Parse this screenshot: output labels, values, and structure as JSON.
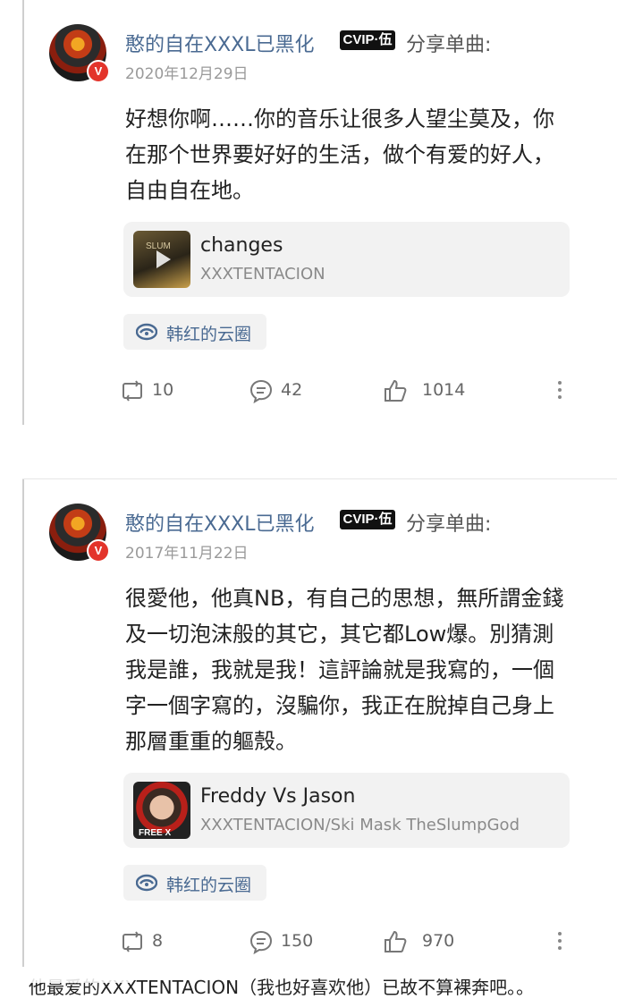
{
  "posts": [
    {
      "username": "憨的自在XXXL已黑化",
      "vip_badge": "CVIP·伍",
      "action": "分享单曲:",
      "date": "2020年12月29日",
      "text": "好想你啊……你的音乐让很多人望尘莫及，你在那个世界要好好的生活，做个有爱的好人，自由自在地。",
      "song": {
        "title": "changes",
        "artist": "XXXTENTACION",
        "cover_text": "SLUM"
      },
      "tag": "韩红的云圈",
      "stats": {
        "reposts": "10",
        "comments": "42",
        "likes": "1014"
      }
    },
    {
      "username": "憨的自在XXXL已黑化",
      "vip_badge": "CVIP·伍",
      "action": "分享单曲:",
      "date": "2017年11月22日",
      "text": "很愛他，他真NB，有自己的思想，無所謂金錢及一切泡沫般的其它，其它都Low爆。別猜測我是誰，我就是我！這評論就是我寫的，一個字一個字寫的，沒騙你，我正在脫掉自己身上那層重重的軀殼。",
      "song": {
        "title": "Freddy Vs Jason",
        "artist": "XXXTENTACION/Ski Mask TheSlumpGod",
        "cover_text": "FREE X"
      },
      "tag": "韩红的云圈",
      "stats": {
        "reposts": "8",
        "comments": "150",
        "likes": "970"
      }
    }
  ],
  "footer": "他最爱的XXXTENTACION（我也好喜欢他）已故不算裸奔吧。。",
  "icons": {
    "badge": "v-badge",
    "repost": "repost-icon",
    "comment": "comment-icon",
    "like": "thumbs-up-icon",
    "more": "more-vertical-icon",
    "tag": "cloud-circle-icon"
  },
  "colors": {
    "link": "#4a6a92",
    "badge": "#e3342b",
    "card_bg": "#f2f2f2"
  }
}
